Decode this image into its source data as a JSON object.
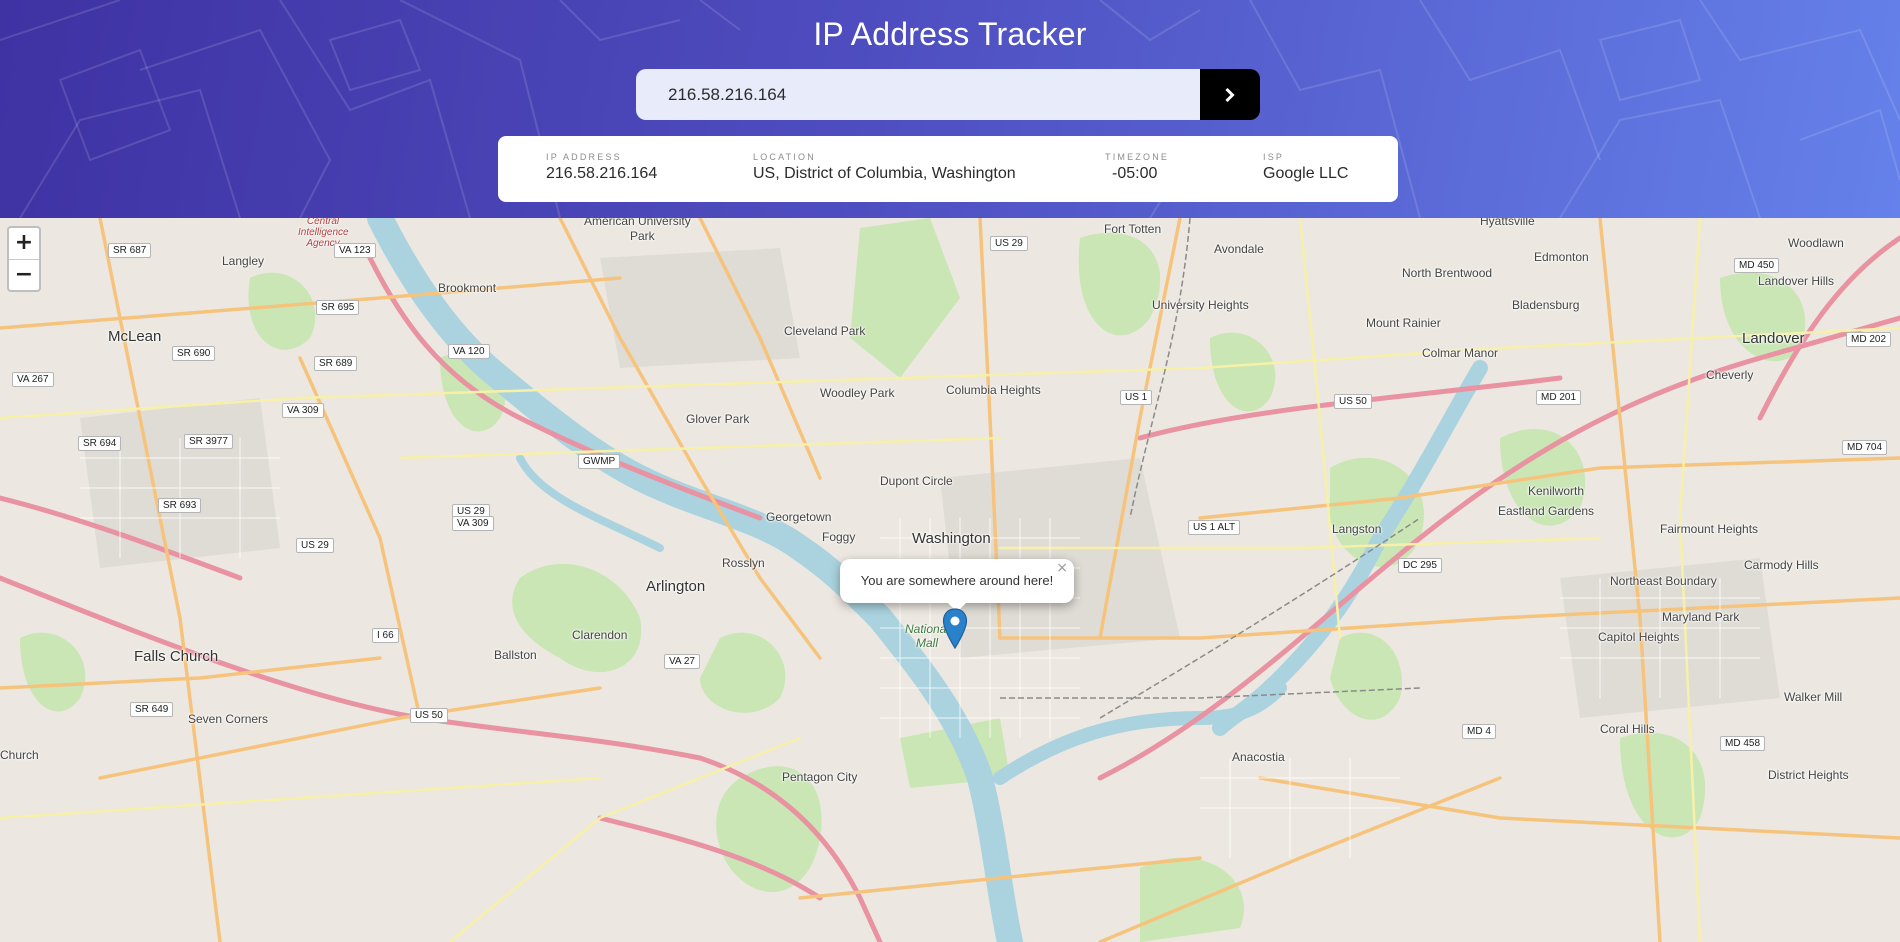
{
  "header": {
    "title": "IP Address Tracker",
    "search_value": "216.58.216.164",
    "search_button": "chevron-right-icon"
  },
  "info": {
    "ip_label": "IP ADDRESS",
    "ip_value": "216.58.216.164",
    "location_label": "LOCATION",
    "location_value": "US, District of Columbia, Washington",
    "timezone_label": "TIMEZONE",
    "timezone_value": "-05:00",
    "isp_label": "ISP",
    "isp_value": "Google LLC"
  },
  "map": {
    "zoom_in": "+",
    "zoom_out": "−",
    "popup_text": "You are somewhere around here!",
    "popup_close": "×",
    "places": {
      "american_university_park": "American University",
      "park": "Park",
      "fort_totten": "Fort Totten",
      "hyattsville": "Hyattsville",
      "woodlawn": "Woodlawn",
      "avondale": "Avondale",
      "edmonton": "Edmonton",
      "north_brentwood": "North Brentwood",
      "landover_hills": "Landover Hills",
      "university_heights": "University Heights",
      "bladensburg": "Bladensburg",
      "langley": "Langley",
      "brookmont": "Brookmont",
      "mclean": "McLean",
      "cleveland_park": "Cleveland Park",
      "mount_rainier": "Mount Rainier",
      "colmar_manor": "Colmar Manor",
      "landover": "Landover",
      "woodley_park": "Woodley Park",
      "columbia_heights": "Columbia Heights",
      "cheverly": "Cheverly",
      "glover_park": "Glover Park",
      "dupont_circle": "Dupont Circle",
      "kenilworth": "Kenilworth",
      "eastland_gardens": "Eastland Gardens",
      "georgetown": "Georgetown",
      "langston": "Langston",
      "rosslyn": "Rosslyn",
      "washington": "Washington",
      "fairmount_heights": "Fairmount Heights",
      "carmody_hills": "Carmody Hills",
      "northeast_boundary": "Northeast Boundary",
      "maryland_park": "Maryland Park",
      "arlington": "Arlington",
      "clarendon": "Clarendon",
      "falls_church": "Falls Church",
      "ballston": "Ballston",
      "capitol_heights": "Capitol Heights",
      "walker_mill": "Walker Mill",
      "seven_corners": "Seven Corners",
      "coral_hills": "Coral Hills",
      "pentagon_city": "Pentagon City",
      "anacostia": "Anacostia",
      "district_heights": "District Heights",
      "church": "Church",
      "national_mall": "National Mall",
      "central_intelligence_agency": "Central Intelligence Agency",
      "foggy": "Foggy"
    },
    "shields": [
      "SR 687",
      "VA 123",
      "US 29",
      "SR 695",
      "SR 690",
      "VA 120",
      "SR 689",
      "VA 267",
      "VA 309",
      "SR 694",
      "SR 3977",
      "SR 693",
      "US 29",
      "VA 309",
      "US 29",
      "GWMP",
      "US 1",
      "US 50",
      "MD 201",
      "MD 450",
      "MD 202",
      "MD 704",
      "US 1 ALT",
      "DC 295",
      "I 66",
      "VA 27",
      "SR 649",
      "US 50",
      "MD 4",
      "MD 458"
    ]
  }
}
